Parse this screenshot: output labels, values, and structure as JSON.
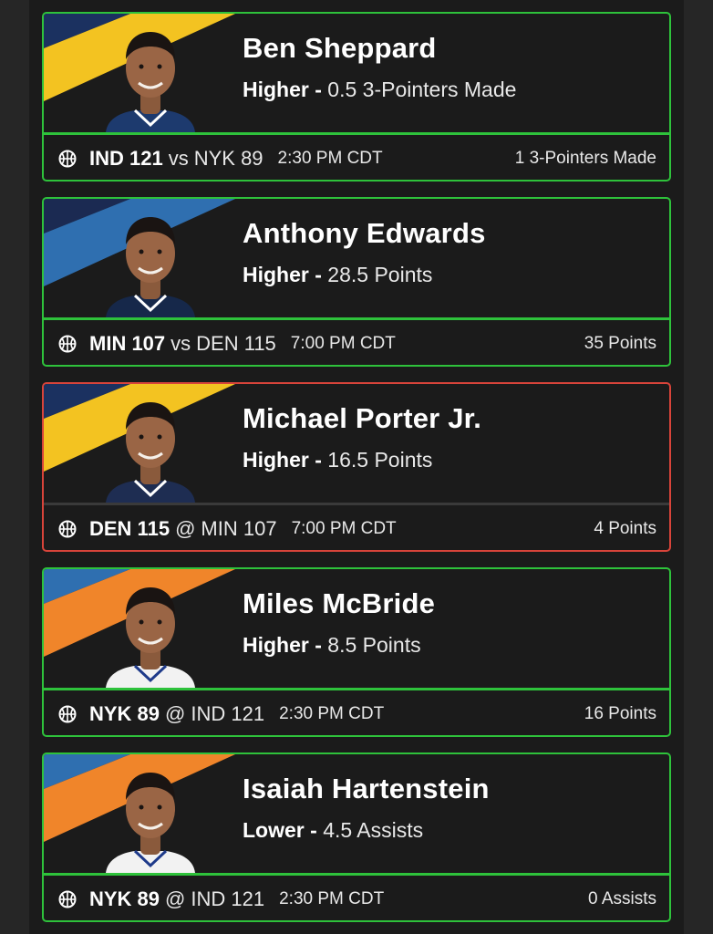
{
  "colors": {
    "win": "#2ec23b",
    "loss": "#d8443a",
    "card_bg": "#1b1b1b"
  },
  "cards": [
    {
      "name": "Ben Sheppard",
      "direction": "Higher",
      "dash": "-",
      "line": "0.5 3-Pointers Made",
      "team_a": "IND 121",
      "separator": "vs",
      "team_b": "NYK 89",
      "time": "2:30 PM CDT",
      "result": "1 3-Pointers Made",
      "status": "win",
      "stripe": "yellow-navy",
      "jersey": "#1d3a6e"
    },
    {
      "name": "Anthony Edwards",
      "direction": "Higher",
      "dash": "-",
      "line": "28.5 Points",
      "team_a": "MIN 107",
      "separator": "vs",
      "team_b": "DEN 115",
      "time": "7:00 PM CDT",
      "result": "35 Points",
      "status": "win",
      "stripe": "blue-navy",
      "jersey": "#16284a"
    },
    {
      "name": "Michael Porter Jr.",
      "direction": "Higher",
      "dash": "-",
      "line": "16.5 Points",
      "team_a": "DEN 115",
      "separator": "@",
      "team_b": "MIN 107",
      "time": "7:00 PM CDT",
      "result": "4 Points",
      "status": "loss",
      "stripe": "yellow-navy",
      "jersey": "#1e2d52"
    },
    {
      "name": "Miles McBride",
      "direction": "Higher",
      "dash": "-",
      "line": "8.5 Points",
      "team_a": "NYK 89",
      "separator": "@",
      "team_b": "IND 121",
      "time": "2:30 PM CDT",
      "result": "16 Points",
      "status": "win",
      "stripe": "orange-blue",
      "jersey": "#f2f2f2"
    },
    {
      "name": "Isaiah Hartenstein",
      "direction": "Lower",
      "dash": "-",
      "line": "4.5 Assists",
      "team_a": "NYK 89",
      "separator": "@",
      "team_b": "IND 121",
      "time": "2:30 PM CDT",
      "result": "0 Assists",
      "status": "win",
      "stripe": "orange-blue",
      "jersey": "#f2f2f2"
    }
  ]
}
